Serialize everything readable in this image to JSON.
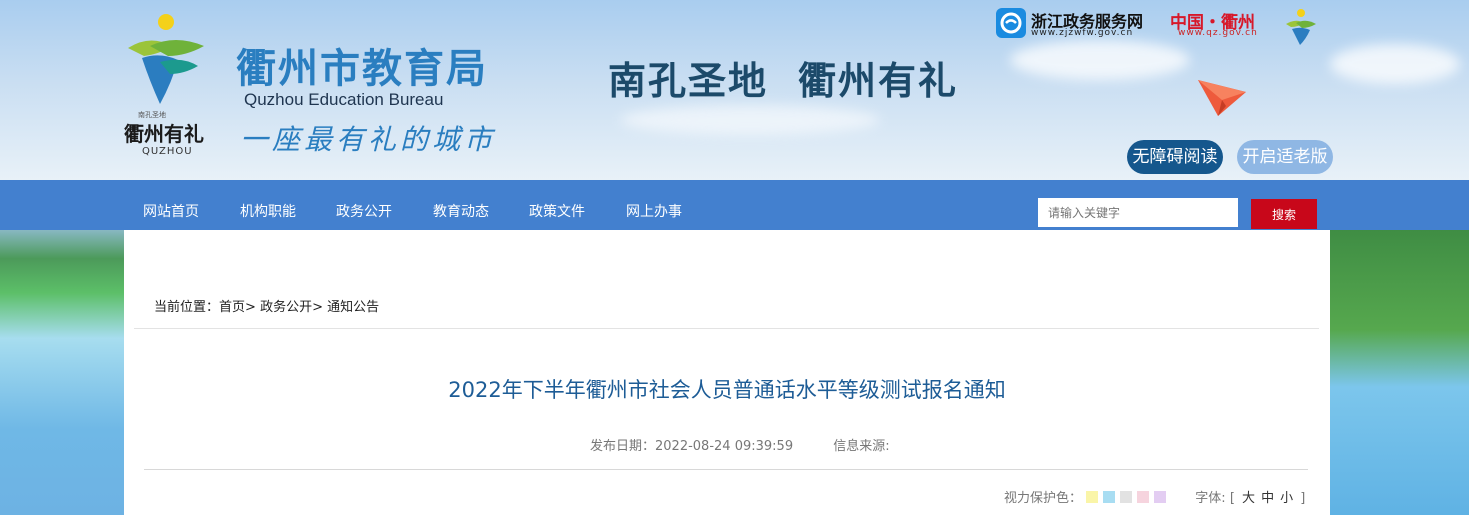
{
  "header": {
    "city_logo_text": "衢州有礼",
    "city_logo_small": "南孔圣地",
    "city_logo_en": "QUZHOU",
    "bureau_cn": "衢州市教育局",
    "bureau_en": "Quzhou Education Bureau",
    "slogan": "一座最有礼的城市",
    "tagline_1": "南孔圣地",
    "tagline_2": "衢州有礼",
    "zj_portal_name": "浙江政务服务网",
    "zj_portal_url": "www.zjzwfw.gov.cn",
    "qz_portal_name": "中国・衢州",
    "qz_portal_url": "www.qz.gov.cn",
    "accessibility_label": "无障碍阅读",
    "elder_mode_label": "开启适老版"
  },
  "nav": {
    "items": [
      {
        "label": "网站首页"
      },
      {
        "label": "机构职能"
      },
      {
        "label": "政务公开"
      },
      {
        "label": "教育动态"
      },
      {
        "label": "政策文件"
      },
      {
        "label": "网上办事"
      }
    ],
    "search_placeholder": "请输入关键字",
    "search_button": "搜索"
  },
  "breadcrumb": {
    "prefix": "当前位置：",
    "items": [
      "首页",
      "政务公开",
      "通知公告"
    ],
    "separator": "> "
  },
  "article": {
    "title": "2022年下半年衢州市社会人员普通话水平等级测试报名通知",
    "publish_label": "发布日期：",
    "publish_date": "2022-08-24 09:39:59",
    "source_label": "信息来源:"
  },
  "tools": {
    "eye_care_label": "视力保护色：",
    "eye_care_colors": [
      "#faf5a8",
      "#a8ddf2",
      "#e2e2e2",
      "#f6d4de",
      "#e3cdf2"
    ],
    "font_label": "字体:",
    "bracket_open": "[",
    "bracket_close": "]",
    "font_large": "大",
    "font_medium": "中",
    "font_small": "小"
  },
  "colors": {
    "nav_bg": "#4380cf",
    "title": "#1d5c96",
    "search_button": "#c8071a",
    "accessibility_button": "#15578d",
    "elder_button": "#8fb7e4"
  }
}
